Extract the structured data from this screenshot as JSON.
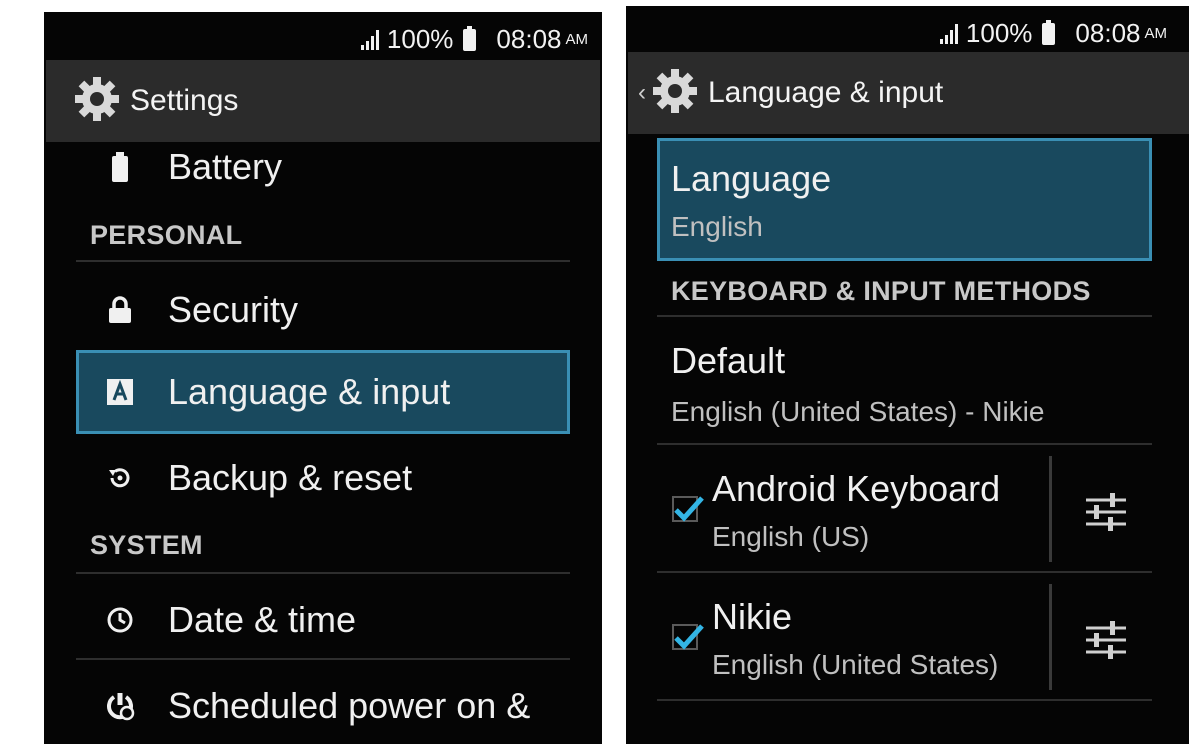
{
  "status": {
    "battery": "100%",
    "time": "08:08",
    "ampm": "AM"
  },
  "left": {
    "title": "Settings",
    "items": [
      {
        "label": "Battery",
        "icon": "battery-icon"
      },
      {
        "label": "Security",
        "icon": "lock-icon"
      },
      {
        "label": "Language & input",
        "icon": "language-input-icon",
        "selected": true
      },
      {
        "label": "Backup & reset",
        "icon": "backup-reset-icon"
      },
      {
        "label": "Date & time",
        "icon": "clock-icon"
      },
      {
        "label": "Scheduled power on &",
        "icon": "scheduled-power-icon"
      }
    ],
    "sections": {
      "personal": "PERSONAL",
      "system": "SYSTEM"
    }
  },
  "right": {
    "title": "Language & input",
    "language": {
      "title": "Language",
      "value": "English"
    },
    "section": "KEYBOARD & INPUT METHODS",
    "default": {
      "title": "Default",
      "value": "English (United States) - Nikie"
    },
    "methods": [
      {
        "title": "Android Keyboard",
        "subtitle": "English (US)",
        "checked": true
      },
      {
        "title": "Nikie",
        "subtitle": "English (United States)",
        "checked": true
      }
    ]
  },
  "colors": {
    "accent": "#33b5e5",
    "selected_bg": "#19495e",
    "actionbar": "#2b2b2b"
  }
}
